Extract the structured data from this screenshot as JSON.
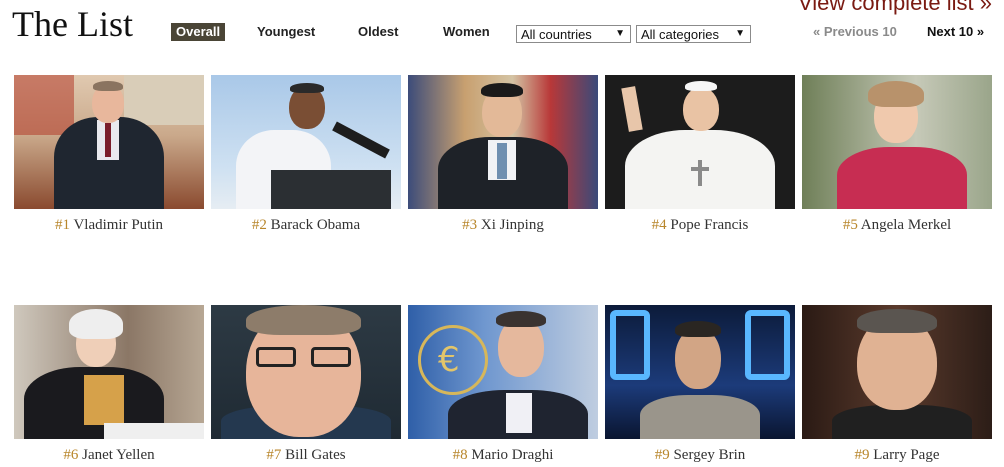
{
  "header": {
    "title": "The List",
    "view_complete": "View complete list »"
  },
  "tabs": [
    {
      "label": "Overall",
      "active": true
    },
    {
      "label": "Youngest",
      "active": false
    },
    {
      "label": "Oldest",
      "active": false
    },
    {
      "label": "Women",
      "active": false
    }
  ],
  "filters": {
    "country": "All countries",
    "category": "All categories"
  },
  "pager": {
    "prev_label": "« Previous 10",
    "next_label": "Next 10 »"
  },
  "colors": {
    "rank": "#b8862b",
    "view_link": "#7a1a12",
    "active_tab_bg": "#4a4536"
  },
  "people": [
    {
      "rank": "#1",
      "name": "Vladimir Putin"
    },
    {
      "rank": "#2",
      "name": "Barack Obama"
    },
    {
      "rank": "#3",
      "name": "Xi Jinping"
    },
    {
      "rank": "#4",
      "name": "Pope Francis"
    },
    {
      "rank": "#5",
      "name": "Angela Merkel"
    },
    {
      "rank": "#6",
      "name": "Janet Yellen"
    },
    {
      "rank": "#7",
      "name": "Bill Gates"
    },
    {
      "rank": "#8",
      "name": "Mario Draghi"
    },
    {
      "rank": "#9",
      "name": "Sergey Brin"
    },
    {
      "rank": "#9",
      "name": "Larry Page"
    }
  ]
}
